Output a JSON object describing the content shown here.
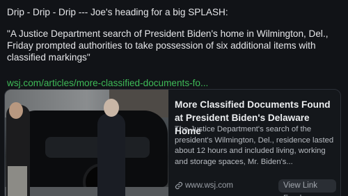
{
  "post": {
    "line1": "Drip - Drip - Drip --- Joe's heading for a big SPLASH:",
    "quote": "\"A Justice Department search of President Biden's home in Wilmington, Del., Friday prompted authorities to take possession of six additional items with classified markings\"",
    "link": "wsj.com/articles/more-classified-documents-fo..."
  },
  "card": {
    "image_alt": "President Biden walking past a black SUV",
    "title": "More Classified Documents Found at President Biden's Delaware Home",
    "description": "The Justice Department's search of the president's Wilmington, Del., residence lasted about 12 hours and included living, working and storage spaces, Mr. Biden's...",
    "source_icon": "link-icon",
    "source": "www.wsj.com",
    "view_button": "View Link Feed"
  },
  "colors": {
    "background": "#111317",
    "link": "#3fbb58",
    "card_border": "#2c3038"
  }
}
